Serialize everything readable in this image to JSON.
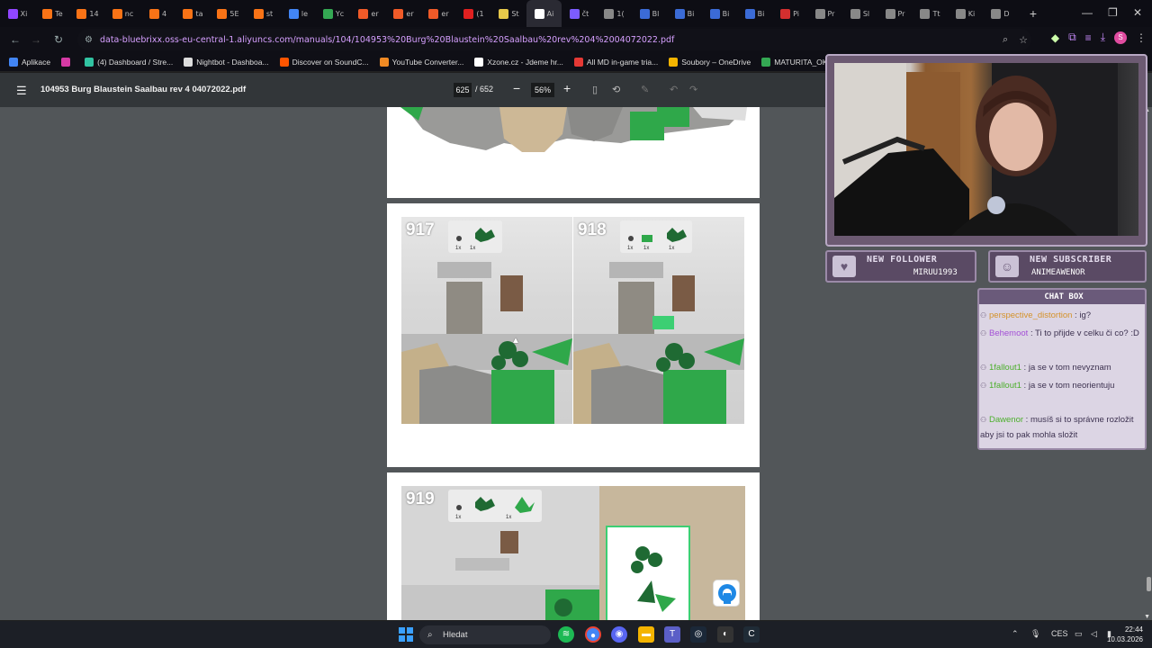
{
  "browser": {
    "tabs": [
      {
        "label": "Xi",
        "color": "#9146ff"
      },
      {
        "label": "Te",
        "color": "#f97316"
      },
      {
        "label": "14",
        "color": "#f97316"
      },
      {
        "label": "nc",
        "color": "#f97316"
      },
      {
        "label": "4",
        "color": "#f97316"
      },
      {
        "label": "ta",
        "color": "#f97316"
      },
      {
        "label": "5E",
        "color": "#f97316"
      },
      {
        "label": "st",
        "color": "#f97316"
      },
      {
        "label": "le",
        "color": "#4285f4"
      },
      {
        "label": "Yc",
        "color": "#34a853"
      },
      {
        "label": "er",
        "color": "#f05a28"
      },
      {
        "label": "er",
        "color": "#f05a28"
      },
      {
        "label": "er",
        "color": "#f05a28"
      },
      {
        "label": "(1",
        "color": "#e02020"
      },
      {
        "label": "St",
        "color": "#e6c84a"
      },
      {
        "label": "Ai",
        "color": "#ffffff"
      },
      {
        "label": "čt",
        "color": "#7c5cff"
      },
      {
        "label": "1(",
        "color": "#888888"
      },
      {
        "label": "Bl",
        "color": "#3b6bd6"
      },
      {
        "label": "Bi",
        "color": "#3b6bd6"
      },
      {
        "label": "Bi",
        "color": "#3b6bd6"
      },
      {
        "label": "Bi",
        "color": "#3b6bd6"
      },
      {
        "label": "Pi",
        "color": "#d32f2f"
      },
      {
        "label": "Pr",
        "color": "#888888"
      },
      {
        "label": "Sl",
        "color": "#888888"
      },
      {
        "label": "Pr",
        "color": "#888888"
      },
      {
        "label": "Tt",
        "color": "#888888"
      },
      {
        "label": "Ki",
        "color": "#888888"
      },
      {
        "label": "D",
        "color": "#888888"
      }
    ],
    "new_tab": "+",
    "window_controls": {
      "minimize": "—",
      "restore": "❐",
      "close": "✕"
    },
    "url": "data-bluebrixx.oss-eu-central-1.aliyuncs.com/manuals/104/104953%20Burg%20Blaustein%20Saalbau%20rev%204%2004072022.pdf",
    "bookmarks": [
      {
        "label": "Aplikace",
        "icon": "apps-grid-icon",
        "color": "#4285f4"
      },
      {
        "label": "",
        "icon": "apps-icon",
        "color": "#d63aa5"
      },
      {
        "label": "(4) Dashboard / Stre...",
        "icon": "streamlabs-icon",
        "color": "#31c3a2"
      },
      {
        "label": "Nightbot - Dashboa...",
        "icon": "nightbot-icon",
        "color": "#dddddd"
      },
      {
        "label": "Discover on SoundC...",
        "icon": "soundcloud-icon",
        "color": "#ff5500"
      },
      {
        "label": "YouTube Converter...",
        "icon": "converter-icon",
        "color": "#f08a24"
      },
      {
        "label": "Xzone.cz - Jdeme hr...",
        "icon": "xzone-icon",
        "color": "#ffffff"
      },
      {
        "label": "All MD in-game tria...",
        "icon": "md-icon",
        "color": "#e53935"
      },
      {
        "label": "Soubory – OneDrive",
        "icon": "onedrive-icon",
        "color": "#f4b400"
      },
      {
        "label": "MATURITA_OKRUH...",
        "icon": "drive-icon",
        "color": "#34a853"
      }
    ]
  },
  "pdf": {
    "title": "104953 Burg Blaustein Saalbau rev 4 04072022.pdf",
    "page_current": "625",
    "page_total": "/ 652",
    "zoom": "56%",
    "steps": [
      {
        "number": "917",
        "parts_qty": [
          "1x",
          "1x"
        ]
      },
      {
        "number": "918",
        "parts_qty": [
          "1x",
          "1x",
          "1x"
        ]
      },
      {
        "number": "919",
        "parts_qty": [
          "1x",
          "1x"
        ]
      }
    ]
  },
  "stream": {
    "new_follower_title": "NEW FOLLOWER",
    "new_follower_name": "MIRUU1993",
    "new_subscriber_title": "NEW SUBSCRIBER",
    "new_subscriber_name": "ANIMEAWENOR",
    "chat_title": "CHAT BOX",
    "chat": [
      {
        "user": "perspective_distortion",
        "color": "#d4922a",
        "text": " : ig?"
      },
      {
        "user": "Behemoot",
        "color": "#a34fd6",
        "text": " : Ti to přijde v celku či co? :D"
      },
      {
        "user": "1fallout1",
        "color": "#4caf2c",
        "text": " : ja se v tom nevyznam"
      },
      {
        "user": "1fallout1",
        "color": "#4caf2c",
        "text": " : ja se v tom neorientuju"
      },
      {
        "user": "Dawenor",
        "color": "#4caf2c",
        "text": " : musíš si to správne rozložit aby jsi to pak mohla složit"
      }
    ]
  },
  "taskbar": {
    "search_placeholder": "Hledat",
    "lang": "CES",
    "time": "22:44",
    "date": "10.03.2026"
  }
}
